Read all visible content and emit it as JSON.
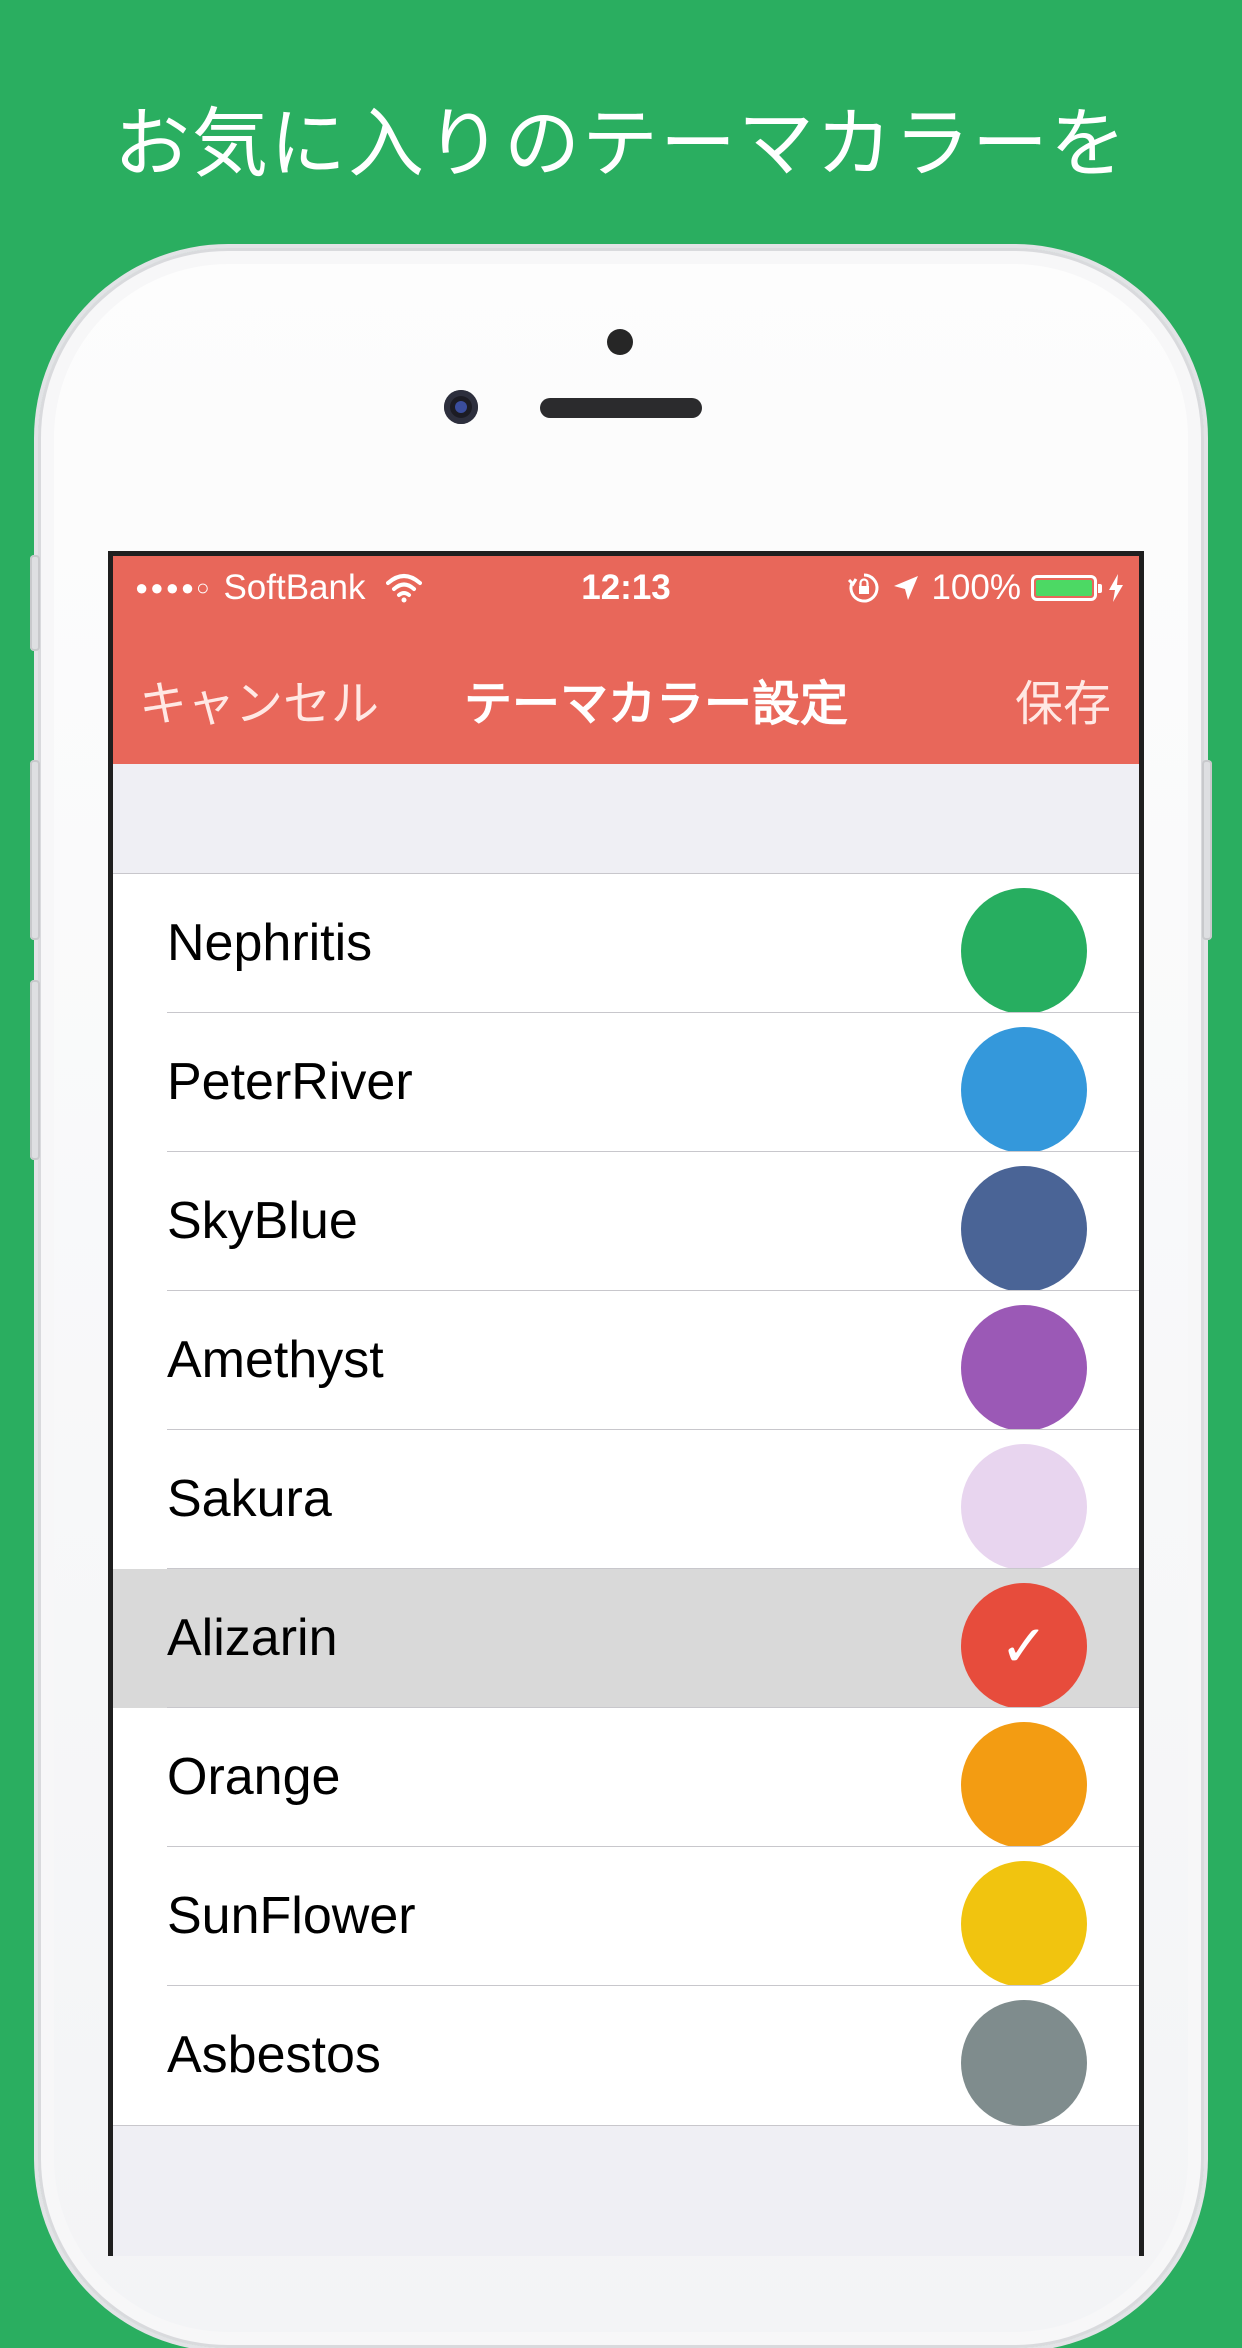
{
  "headline": "お気に入りのテーマカラーを",
  "status_bar": {
    "carrier": "SoftBank",
    "signal_dots": "●●●●○",
    "time": "12:13",
    "battery_percent": "100%",
    "battery_level": 1.0
  },
  "navbar": {
    "cancel_label": "キャンセル",
    "title": "テーマカラー設定",
    "save_label": "保存",
    "background_color": "#e8675a"
  },
  "themes": [
    {
      "name": "Nephritis",
      "color": "#27ae60",
      "selected": false
    },
    {
      "name": "PeterRiver",
      "color": "#3498db",
      "selected": false
    },
    {
      "name": "SkyBlue",
      "color": "#4a6496",
      "selected": false
    },
    {
      "name": "Amethyst",
      "color": "#9b59b6",
      "selected": false
    },
    {
      "name": "Sakura",
      "color": "#e8d5ef",
      "selected": false
    },
    {
      "name": "Alizarin",
      "color": "#e74c3c",
      "selected": true
    },
    {
      "name": "Orange",
      "color": "#f39c12",
      "selected": false
    },
    {
      "name": "SunFlower",
      "color": "#f1c40f",
      "selected": false
    },
    {
      "name": "Asbestos",
      "color": "#7f8c8d",
      "selected": false
    }
  ],
  "check_mark": "✓",
  "page_background": "#2aae60"
}
